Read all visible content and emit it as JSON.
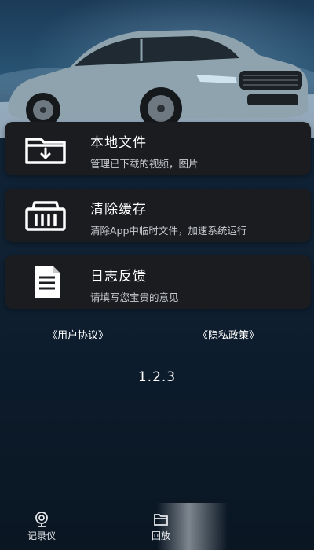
{
  "menu": [
    {
      "title": "本地文件",
      "subtitle": "管理已下载的视频，图片",
      "icon": "folder-download-icon"
    },
    {
      "title": "清除缓存",
      "subtitle": "清除App中临时文件，加速系统运行",
      "icon": "basket-icon"
    },
    {
      "title": "日志反馈",
      "subtitle": "请填写您宝贵的意见",
      "icon": "document-icon"
    }
  ],
  "links": {
    "user_agreement": "《用户协议》",
    "privacy_policy": "《隐私政策》"
  },
  "version": "1.2.3",
  "tabbar": [
    {
      "label": "记录仪",
      "icon": "camera-icon"
    },
    {
      "label": "回放",
      "icon": "folder-icon"
    }
  ]
}
